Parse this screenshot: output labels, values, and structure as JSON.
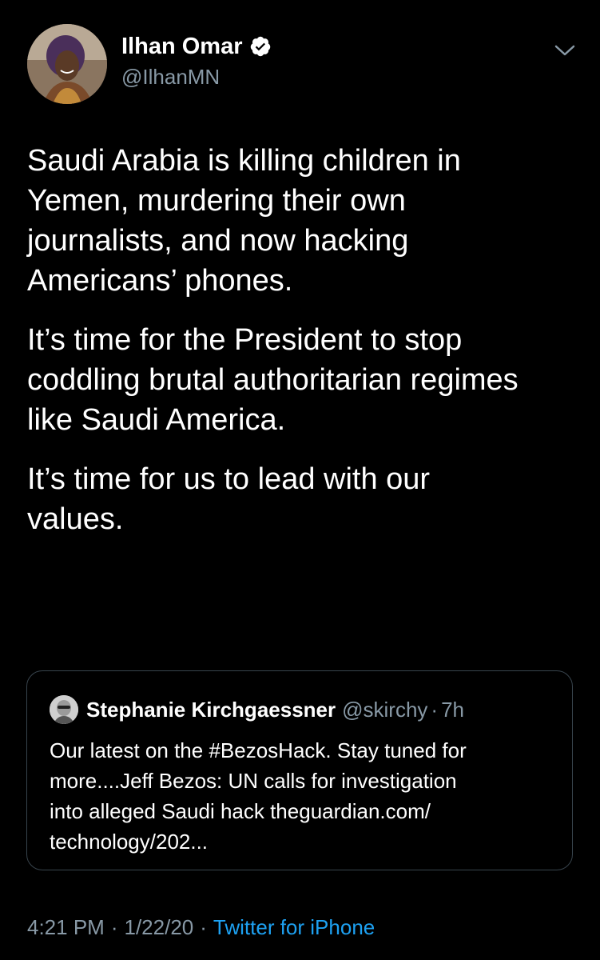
{
  "author": {
    "display_name": "Ilhan Omar",
    "handle": "@IlhanMN",
    "verified": true
  },
  "tweet": {
    "paragraphs": [
      "Saudi Arabia is killing children in\nYemen, murdering their own\njournalists, and now hacking\nAmericans’ phones.",
      "It’s time for the President to stop\ncoddling brutal authoritarian regimes\nlike Saudi America.",
      "It’s time for us to lead with our\nvalues."
    ]
  },
  "quoted_tweet": {
    "display_name": "Stephanie Kirchgaessner",
    "handle": "@skirchy",
    "separator": "·",
    "time": "7h",
    "text": "Our latest on the #BezosHack. Stay tuned for\nmore....Jeff Bezos: UN calls for  investigation\ninto alleged Saudi hack theguardian.com/\ntechnology/202..."
  },
  "footer": {
    "time": "4:21 PM",
    "separator": "·",
    "date": "1/22/20",
    "source": "Twitter for iPhone"
  },
  "colors": {
    "background": "#000000",
    "primary_text": "#ffffff",
    "secondary_text": "#8899a6",
    "link": "#1da1f2",
    "border": "#38444d"
  },
  "icons": {
    "verified": "verified-badge-icon",
    "caret": "chevron-down-icon"
  }
}
